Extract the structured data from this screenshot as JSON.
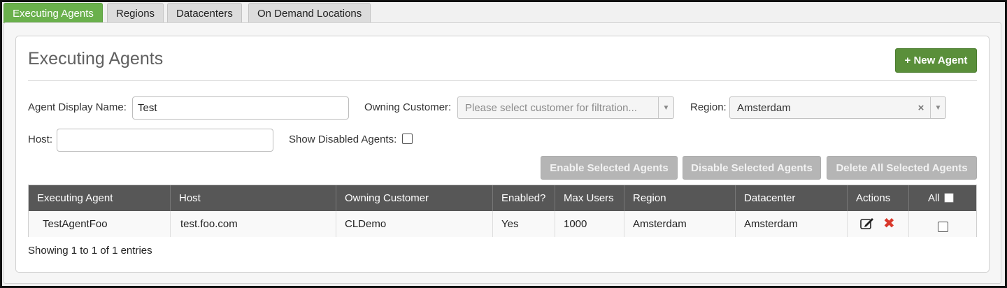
{
  "tabs": [
    {
      "label": "Executing Agents",
      "active": true
    },
    {
      "label": "Regions",
      "active": false
    },
    {
      "label": "Datacenters",
      "active": false
    },
    {
      "label": "On Demand Locations",
      "active": false
    }
  ],
  "page": {
    "title": "Executing Agents",
    "new_agent_label": "+ New Agent"
  },
  "filters": {
    "agent_display_name_label": "Agent Display Name:",
    "agent_display_name_value": "Test",
    "owning_customer_label": "Owning Customer:",
    "owning_customer_placeholder": "Please select customer for filtration...",
    "region_label": "Region:",
    "region_value": "Amsterdam",
    "host_label": "Host:",
    "host_value": "",
    "show_disabled_label": "Show Disabled Agents:",
    "show_disabled_checked": false
  },
  "actions": {
    "enable_label": "Enable Selected Agents",
    "disable_label": "Disable Selected Agents",
    "delete_label": "Delete All Selected Agents"
  },
  "table": {
    "headers": {
      "agent": "Executing Agent",
      "host": "Host",
      "customer": "Owning Customer",
      "enabled": "Enabled?",
      "max_users": "Max Users",
      "region": "Region",
      "datacenter": "Datacenter",
      "actions": "Actions",
      "all": "All"
    },
    "rows": [
      {
        "agent": "TestAgentFoo",
        "host": "test.foo.com",
        "customer": "CLDemo",
        "enabled": "Yes",
        "max_users": "1000",
        "region": "Amsterdam",
        "datacenter": "Amsterdam",
        "selected": false
      }
    ]
  },
  "footer": {
    "entries_text": "Showing 1 to 1 of 1 entries"
  },
  "colors": {
    "active_tab": "#6ab04c",
    "primary_button": "#5a8f3a",
    "table_header": "#575757",
    "delete_icon": "#d9382b"
  },
  "icons": {
    "edit": "edit-icon",
    "delete": "delete-icon",
    "dropdown": "chevron-down-icon",
    "clear": "clear-icon"
  }
}
